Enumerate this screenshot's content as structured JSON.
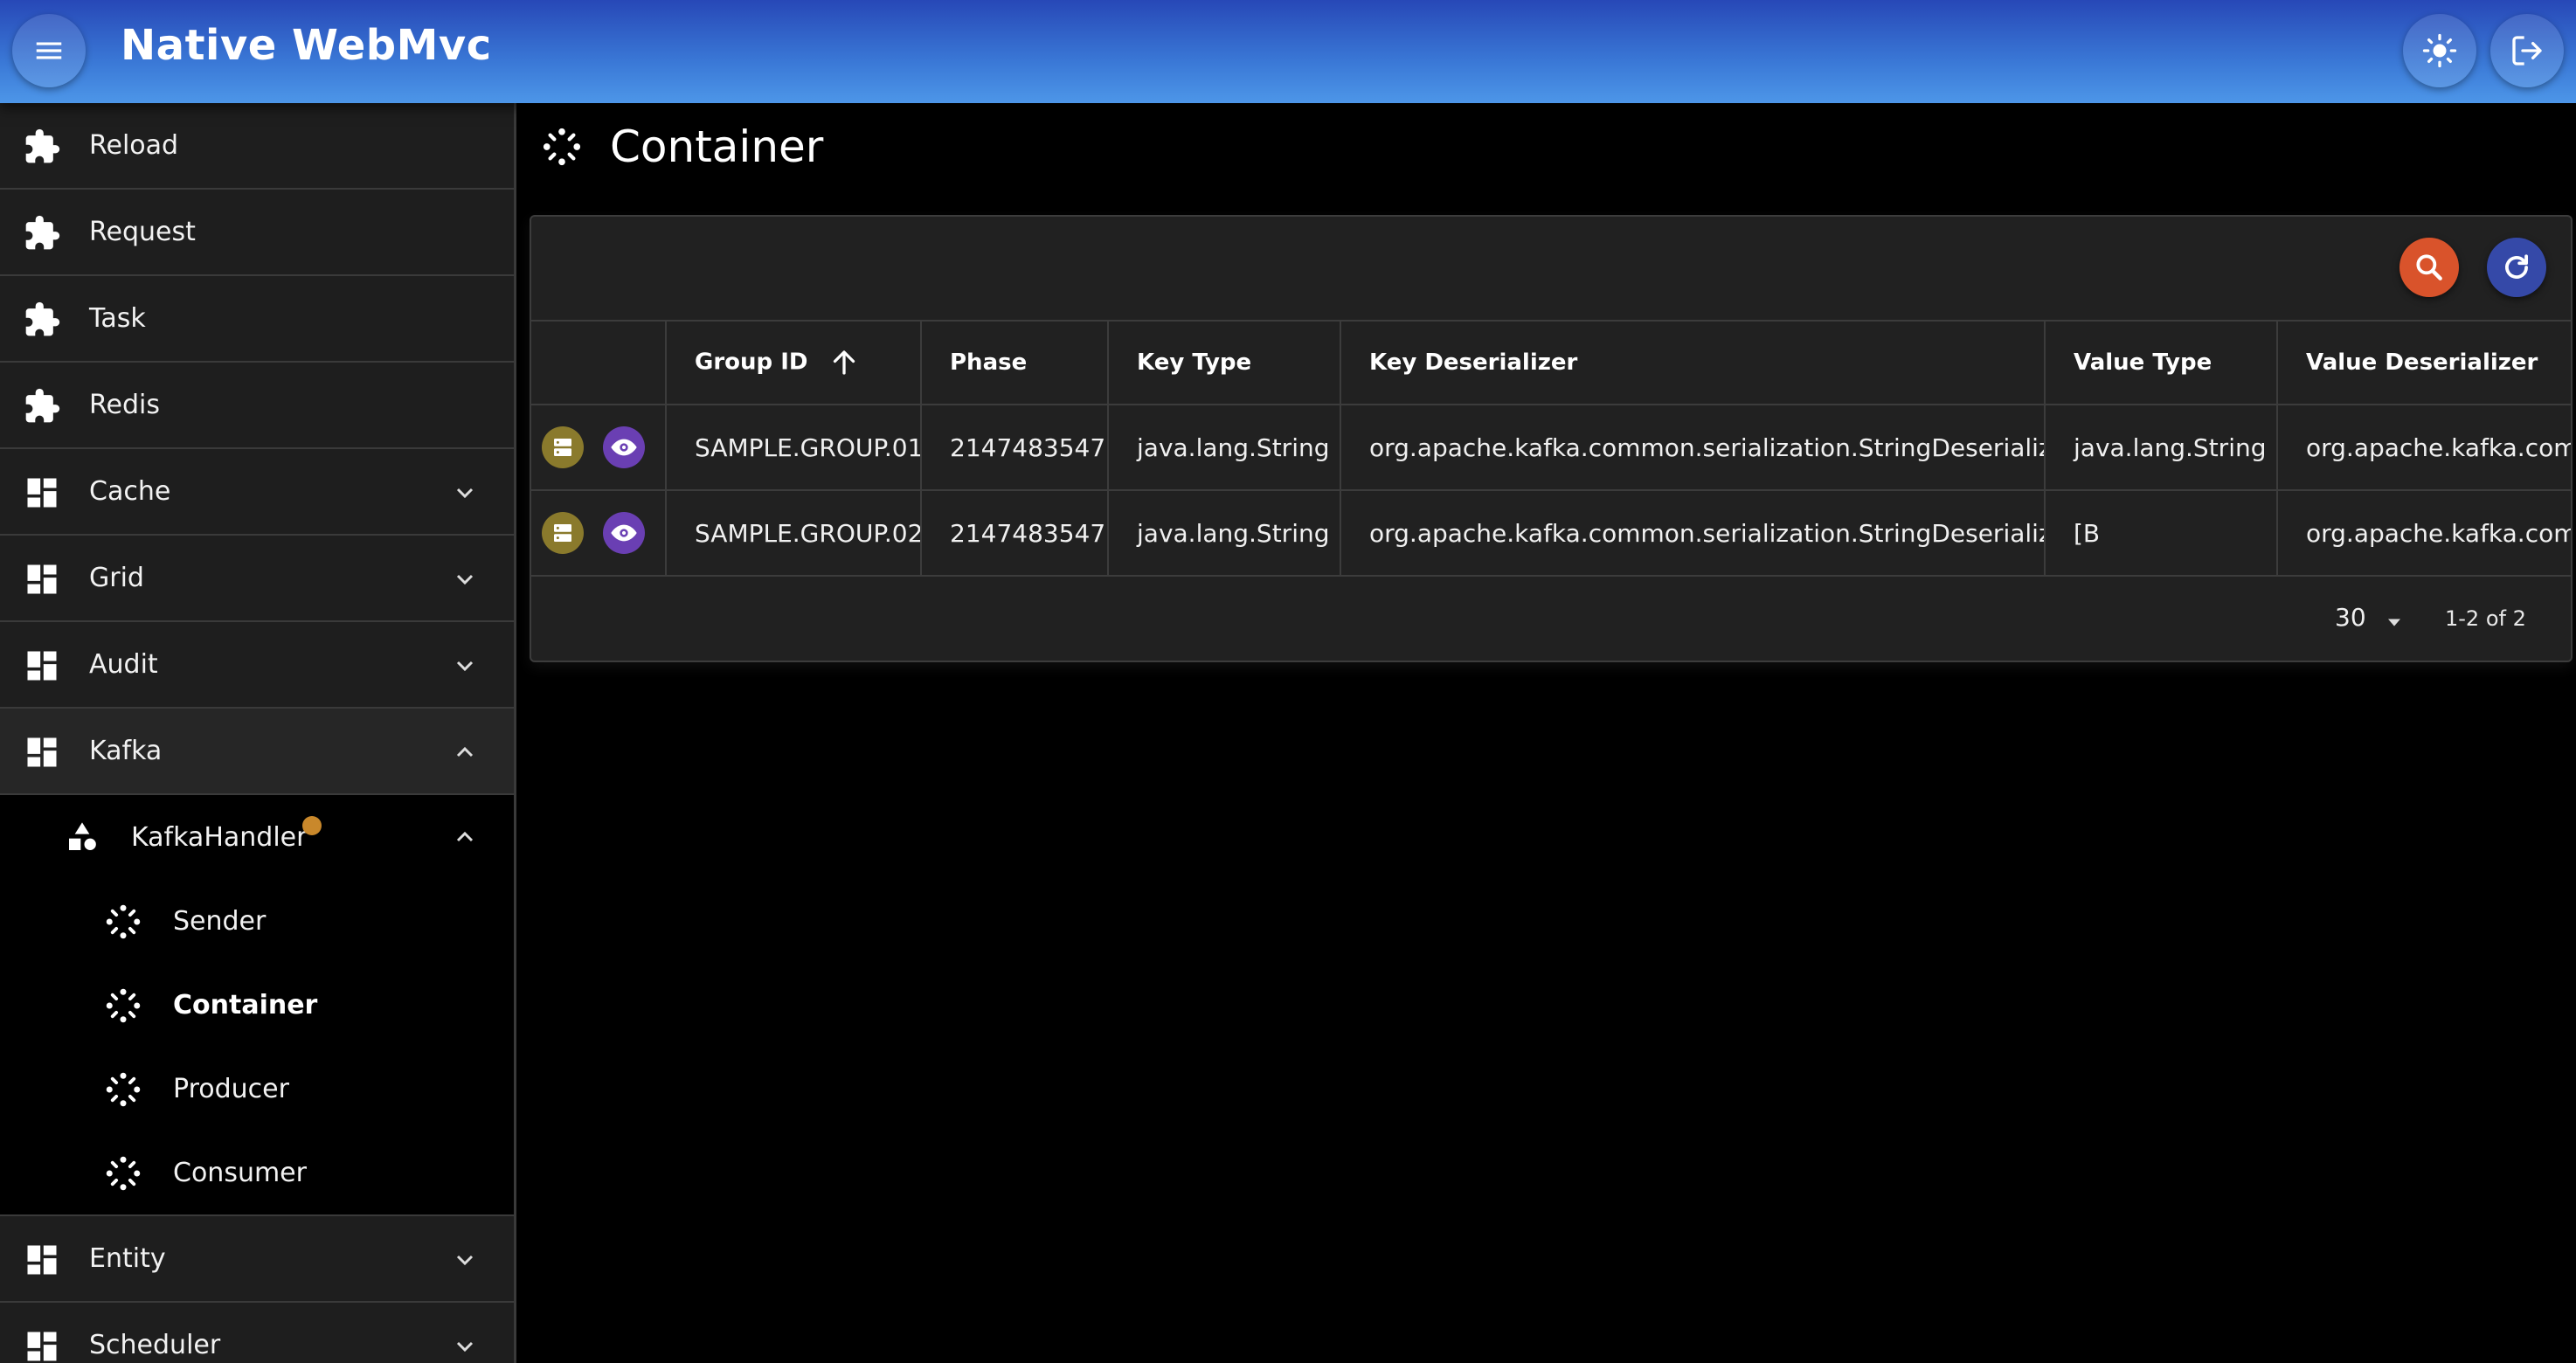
{
  "app": {
    "title": "Native WebMvc"
  },
  "sidebar": {
    "top_items": [
      {
        "label": "Reload",
        "icon": "puzzle-icon"
      },
      {
        "label": "Request",
        "icon": "puzzle-icon"
      },
      {
        "label": "Task",
        "icon": "puzzle-icon"
      },
      {
        "label": "Redis",
        "icon": "puzzle-icon"
      },
      {
        "label": "Cache",
        "icon": "dashboard-icon",
        "expandable": true
      },
      {
        "label": "Grid",
        "icon": "dashboard-icon",
        "expandable": true
      },
      {
        "label": "Audit",
        "icon": "dashboard-icon",
        "expandable": true
      },
      {
        "label": "Kafka",
        "icon": "dashboard-icon",
        "expanded": true
      }
    ],
    "kafka_handler": {
      "label": "KafkaHandler",
      "icon": "shapes-icon",
      "badge_color": "#c9882b"
    },
    "kafka_children": [
      {
        "label": "Sender"
      },
      {
        "label": "Container",
        "current": true
      },
      {
        "label": "Producer"
      },
      {
        "label": "Consumer"
      }
    ],
    "bottom_items": [
      {
        "label": "Entity",
        "icon": "dashboard-icon"
      },
      {
        "label": "Scheduler",
        "icon": "dashboard-icon"
      }
    ]
  },
  "page": {
    "title": "Container",
    "icon": "spinner-icon"
  },
  "table": {
    "columns": [
      "Group ID",
      "Phase",
      "Key Type",
      "Key Deserializer",
      "Value Type",
      "Value Deserializer"
    ],
    "sorted_column": "Group ID",
    "sort_direction": "ascending",
    "rows": [
      {
        "group_id": "SAMPLE.GROUP.01",
        "phase": "2147483547",
        "key_type": "java.lang.String",
        "key_deserializer": "org.apache.kafka.common.serialization.StringDeserializer",
        "value_type": "java.lang.String",
        "value_deserializer": "org.apache.kafka.common.serialization.StringDeserializer"
      },
      {
        "group_id": "SAMPLE.GROUP.02",
        "phase": "2147483547",
        "key_type": "java.lang.String",
        "key_deserializer": "org.apache.kafka.common.serialization.StringDeserializer",
        "value_type": "[B",
        "value_deserializer": "org.apache.kafka.common.serialization.StringDeserializer"
      }
    ]
  },
  "pagination": {
    "per_page": "30",
    "range": "1-2 of 2"
  },
  "colors": {
    "appbar_start": "#2748b7",
    "appbar_end": "#4d96e8",
    "search_button": "#d9532b",
    "refresh_button": "#3549a8",
    "server_action": "#8a7a2c",
    "view_action": "#6a3fb3"
  }
}
